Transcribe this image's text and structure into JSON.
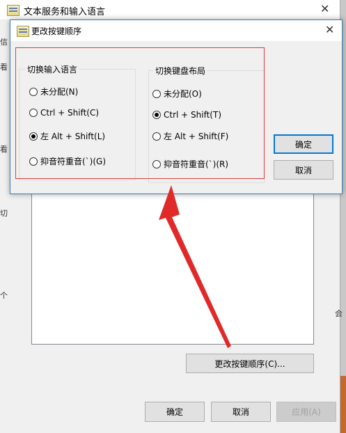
{
  "parent_window": {
    "title": "文本服务和输入语言",
    "side_chars": [
      "信",
      "看",
      "看",
      "切",
      "个"
    ],
    "right_char": "会",
    "change_key_sequence_button": "更改按键顺序(C)...",
    "ok_button": "确定",
    "cancel_button": "取消",
    "apply_button": "应用(A)"
  },
  "dialog": {
    "title": "更改按键顺序",
    "ok_button": "确定",
    "cancel_button": "取消",
    "switch_input_language": {
      "legend": "切换输入语言",
      "options": [
        "未分配(N)",
        "Ctrl + Shift(C)",
        "左 Alt + Shift(L)",
        "抑音符重音(`)(G)"
      ],
      "selected_index": 2
    },
    "switch_keyboard_layout": {
      "legend": "切换键盘布局",
      "options": [
        "未分配(O)",
        "Ctrl + Shift(T)",
        "左 Alt + Shift(F)",
        "抑音符重音(`)(R)"
      ],
      "selected_index": 1
    }
  },
  "colors": {
    "highlight_box": "#e23b3b",
    "arrow": "#e02a2a",
    "focus_border": "#0078d7"
  },
  "icons": [
    "app-keyboard-icon",
    "close-icon",
    "radio-button-icon",
    "annotation-arrow-icon"
  ]
}
